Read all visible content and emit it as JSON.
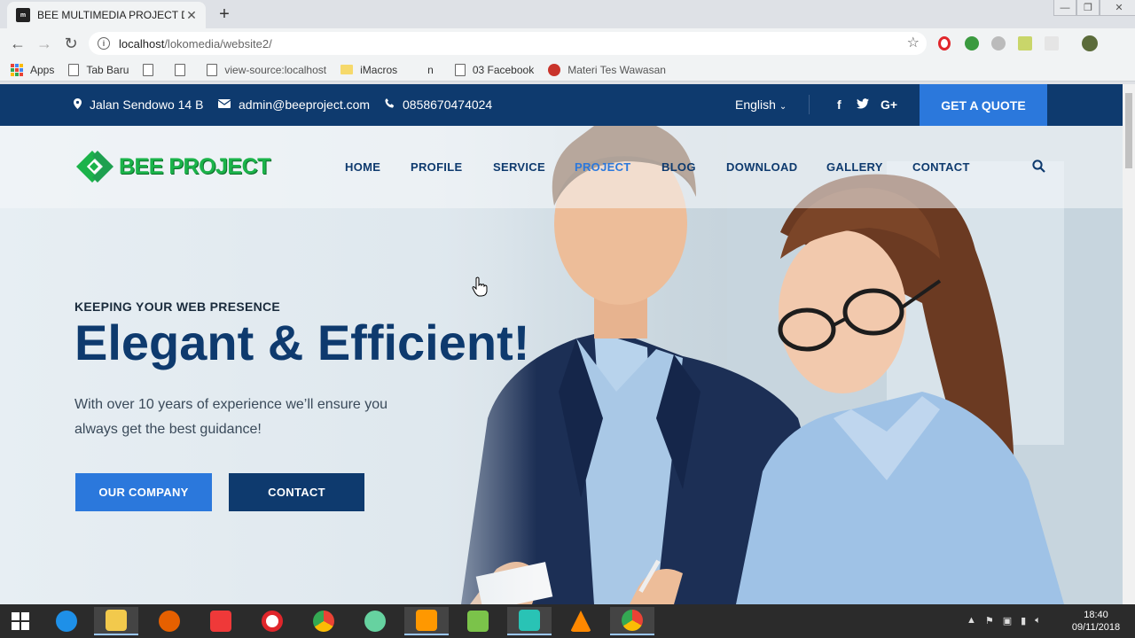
{
  "browser": {
    "tab_title": "BEE MULTIMEDIA PROJECT DEVE",
    "tab_favicon_text": "m",
    "url_host": "localhost",
    "url_path": "/lokomedia/website2/",
    "bookmarks": [
      {
        "label": "Apps",
        "icon": "apps-grid-icon"
      },
      {
        "label": "Tab Baru",
        "icon": "page-icon"
      },
      {
        "label": "",
        "icon": "page-icon"
      },
      {
        "label": "",
        "icon": "page-icon"
      },
      {
        "label": "view-source:localhost",
        "icon": "page-icon"
      },
      {
        "label": "iMacros",
        "icon": "folder-icon"
      },
      {
        "label": "n",
        "icon": "none"
      },
      {
        "label": "03 Facebook",
        "icon": "page-icon"
      },
      {
        "label": "Materi Tes Wawasan",
        "icon": "red-circle-icon"
      }
    ]
  },
  "topbar": {
    "address": "Jalan Sendowo 14 B",
    "email": "admin@beeproject.com",
    "phone": "0858670474024",
    "language": "English",
    "social": [
      "f",
      "t",
      "G+"
    ],
    "quote_label": "GET A QUOTE"
  },
  "site": {
    "logo_text": "BEE PROJECT",
    "menu": [
      "HOME",
      "PROFILE",
      "SERVICE",
      "PROJECT",
      "BLOG",
      "DOWNLOAD",
      "GALLERY",
      "CONTACT"
    ],
    "active_menu": "PROJECT"
  },
  "hero": {
    "eyebrow": "KEEPING YOUR WEB PRESENCE",
    "headline": "Elegant & Efficient!",
    "lead": "With over 10 years of experience we’ll ensure you always get the best guidance!",
    "btn_primary": "OUR COMPANY",
    "btn_secondary": "CONTACT"
  },
  "taskbar": {
    "time": "18:40",
    "date": "09/11/2018"
  },
  "colors": {
    "navy": "#0e3a6e",
    "accent_blue": "#2b78dc",
    "logo_green": "#1bb34a"
  }
}
